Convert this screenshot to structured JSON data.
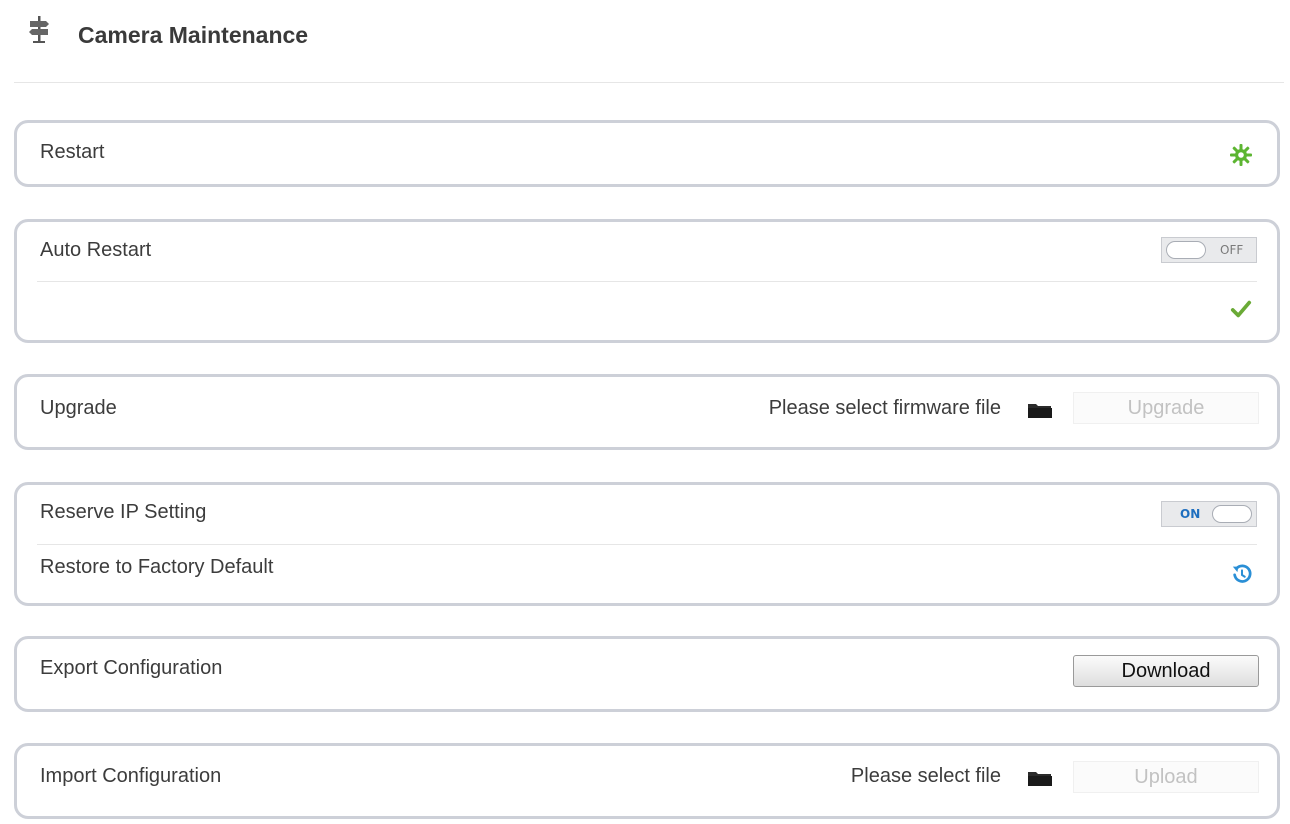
{
  "page": {
    "title": "Camera Maintenance",
    "header_icon": "signpost-icon"
  },
  "restart": {
    "label": "Restart",
    "icon": "restart-gear-icon",
    "icon_color": "#5cb531"
  },
  "auto_restart": {
    "label": "Auto Restart",
    "toggle_state": "OFF",
    "confirm_icon": "check-icon",
    "confirm_color": "#6aaa36"
  },
  "upgrade": {
    "label": "Upgrade",
    "file_placeholder": "Please select firmware file",
    "browse_icon": "folder-icon",
    "button_label": "Upgrade"
  },
  "reserve_ip": {
    "label": "Reserve IP Setting",
    "toggle_state": "ON",
    "toggle_color": "#1f6fbf"
  },
  "factory_default": {
    "label": "Restore to Factory Default",
    "icon": "restore-icon",
    "icon_color": "#2a8fd6"
  },
  "export": {
    "label": "Export Configuration",
    "button_label": "Download"
  },
  "import": {
    "label": "Import Configuration",
    "file_placeholder": "Please select file",
    "browse_icon": "folder-icon",
    "button_label": "Upload"
  }
}
